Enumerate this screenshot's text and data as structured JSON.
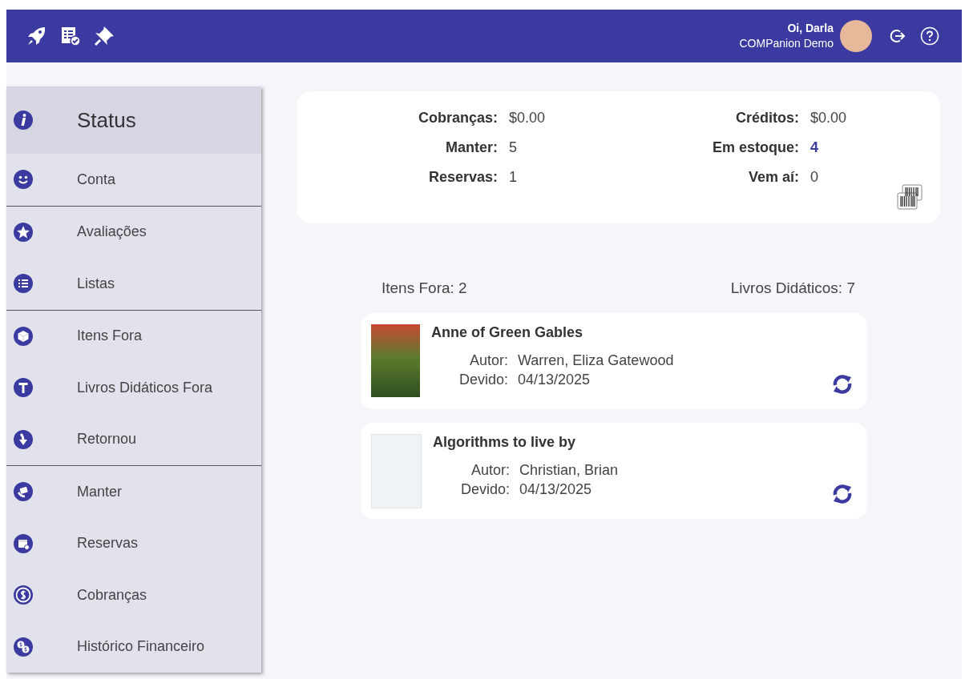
{
  "header": {
    "greeting": "Oi, Darla",
    "site": "COMPanion Demo"
  },
  "sidebar": {
    "groups": [
      {
        "items": [
          {
            "label": "Status",
            "selected": true
          },
          {
            "label": "Conta",
            "selected": false
          }
        ]
      },
      {
        "items": [
          {
            "label": "Avaliações",
            "selected": false
          },
          {
            "label": "Listas",
            "selected": false
          }
        ]
      },
      {
        "items": [
          {
            "label": "Itens Fora",
            "selected": false
          },
          {
            "label": "Livros Didáticos Fora",
            "selected": false
          },
          {
            "label": "Retornou",
            "selected": false
          }
        ]
      },
      {
        "items": [
          {
            "label": "Manter",
            "selected": false
          },
          {
            "label": "Reservas",
            "selected": false
          },
          {
            "label": "Cobranças",
            "selected": false
          },
          {
            "label": "Histórico Financeiro",
            "selected": false
          }
        ]
      }
    ]
  },
  "summary": {
    "stats": [
      {
        "label": "Cobranças:",
        "value": "$0.00",
        "emphasized": false
      },
      {
        "label": "Créditos:",
        "value": "$0.00",
        "emphasized": false
      },
      {
        "label": "Manter:",
        "value": "5",
        "emphasized": false
      },
      {
        "label": "Em estoque:",
        "value": "4",
        "emphasized": true
      },
      {
        "label": "Reservas:",
        "value": "1",
        "emphasized": false
      },
      {
        "label": "Vem aí:",
        "value": "0",
        "emphasized": false
      }
    ]
  },
  "counts": {
    "items_out": "Itens Fora: 2",
    "textbooks": "Livros Didáticos: 7"
  },
  "items": [
    {
      "title": "Anne of Green Gables",
      "author_label": "Autor:",
      "author": "Warren, Eliza Gatewood",
      "due_label": "Devido:",
      "due": "04/13/2025"
    },
    {
      "title": "Algorithms to live by",
      "author_label": "Autor:",
      "author": "Christian, Brian",
      "due_label": "Devido:",
      "due": "04/13/2025"
    }
  ]
}
